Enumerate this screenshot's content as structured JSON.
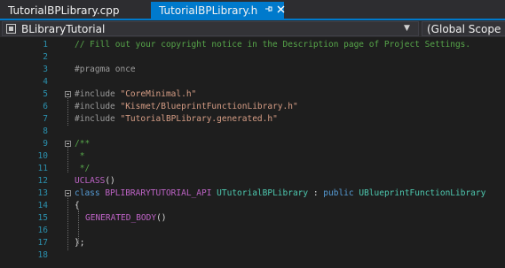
{
  "tabs": [
    {
      "label": "TutorialBPLibrary.cpp",
      "active": false
    },
    {
      "label": "TutorialBPLibrary.h",
      "active": true,
      "pin_icon": "pin-icon",
      "close_icon": "close-icon"
    }
  ],
  "navbar": {
    "project": "BLibraryTutorial",
    "scope": "(Global Scope"
  },
  "colors": {
    "accent": "#007acc",
    "line_number": "#2b91af",
    "comment": "#57a64a",
    "keyword": "#569cd6",
    "string": "#d69d85",
    "macro": "#bd63c5",
    "type": "#4ec9b0"
  },
  "code_lines": [
    {
      "n": "1",
      "text": "// Fill out your copyright notice in the Description page of Project Settings."
    },
    {
      "n": "2",
      "text": ""
    },
    {
      "n": "3",
      "text": "#pragma once"
    },
    {
      "n": "4",
      "text": ""
    },
    {
      "n": "5",
      "pp": "#include ",
      "str": "\"CoreMinimal.h\""
    },
    {
      "n": "6",
      "pp": "#include ",
      "str": "\"Kismet/BlueprintFunctionLibrary.h\""
    },
    {
      "n": "7",
      "pp": "#include ",
      "str": "\"TutorialBPLibrary.generated.h\""
    },
    {
      "n": "8",
      "text": ""
    },
    {
      "n": "9",
      "text": "/**"
    },
    {
      "n": "10",
      "text": " *"
    },
    {
      "n": "11",
      "text": " */"
    },
    {
      "n": "12",
      "macro": "UCLASS",
      "rest": "()"
    },
    {
      "n": "13",
      "kw": "class ",
      "macro": "BPLIBRARYTUTORIAL_API ",
      "type": "UTutorialBPLibrary",
      "plain": " : ",
      "kw2": "public ",
      "type2": "UBlueprintFunctionLibrary"
    },
    {
      "n": "14",
      "text": "{"
    },
    {
      "n": "15",
      "macro": "GENERATED_BODY",
      "rest": "()"
    },
    {
      "n": "16",
      "text": ""
    },
    {
      "n": "17",
      "text": "};"
    },
    {
      "n": "18",
      "text": ""
    }
  ]
}
